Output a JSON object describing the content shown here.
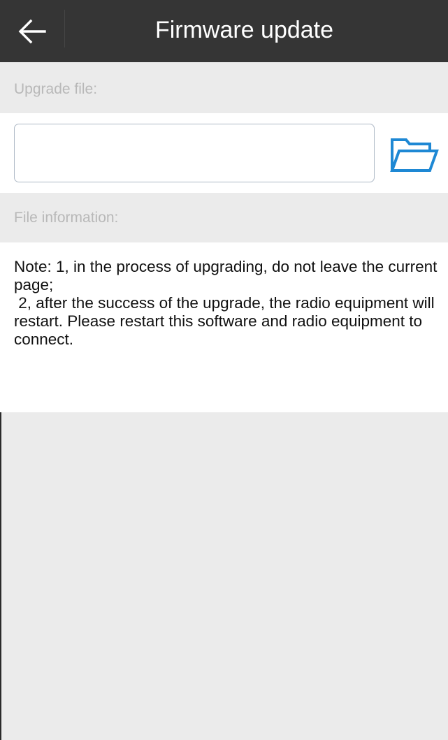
{
  "header": {
    "back_icon": "arrow-left-icon",
    "title": "Firmware update"
  },
  "upgrade_file": {
    "label": "Upgrade file:",
    "value": "",
    "placeholder": "",
    "browse_icon": "folder-open-icon"
  },
  "file_information": {
    "label": "File information:"
  },
  "note": {
    "text": "Note: 1, in the process of upgrading, do not leave the current page;\n 2, after the success of the upgrade, the radio equipment will restart. Please restart this software and radio equipment to connect."
  },
  "colors": {
    "header_bg": "#353535",
    "accent": "#1e88d4",
    "section_bg": "#ebebeb"
  }
}
